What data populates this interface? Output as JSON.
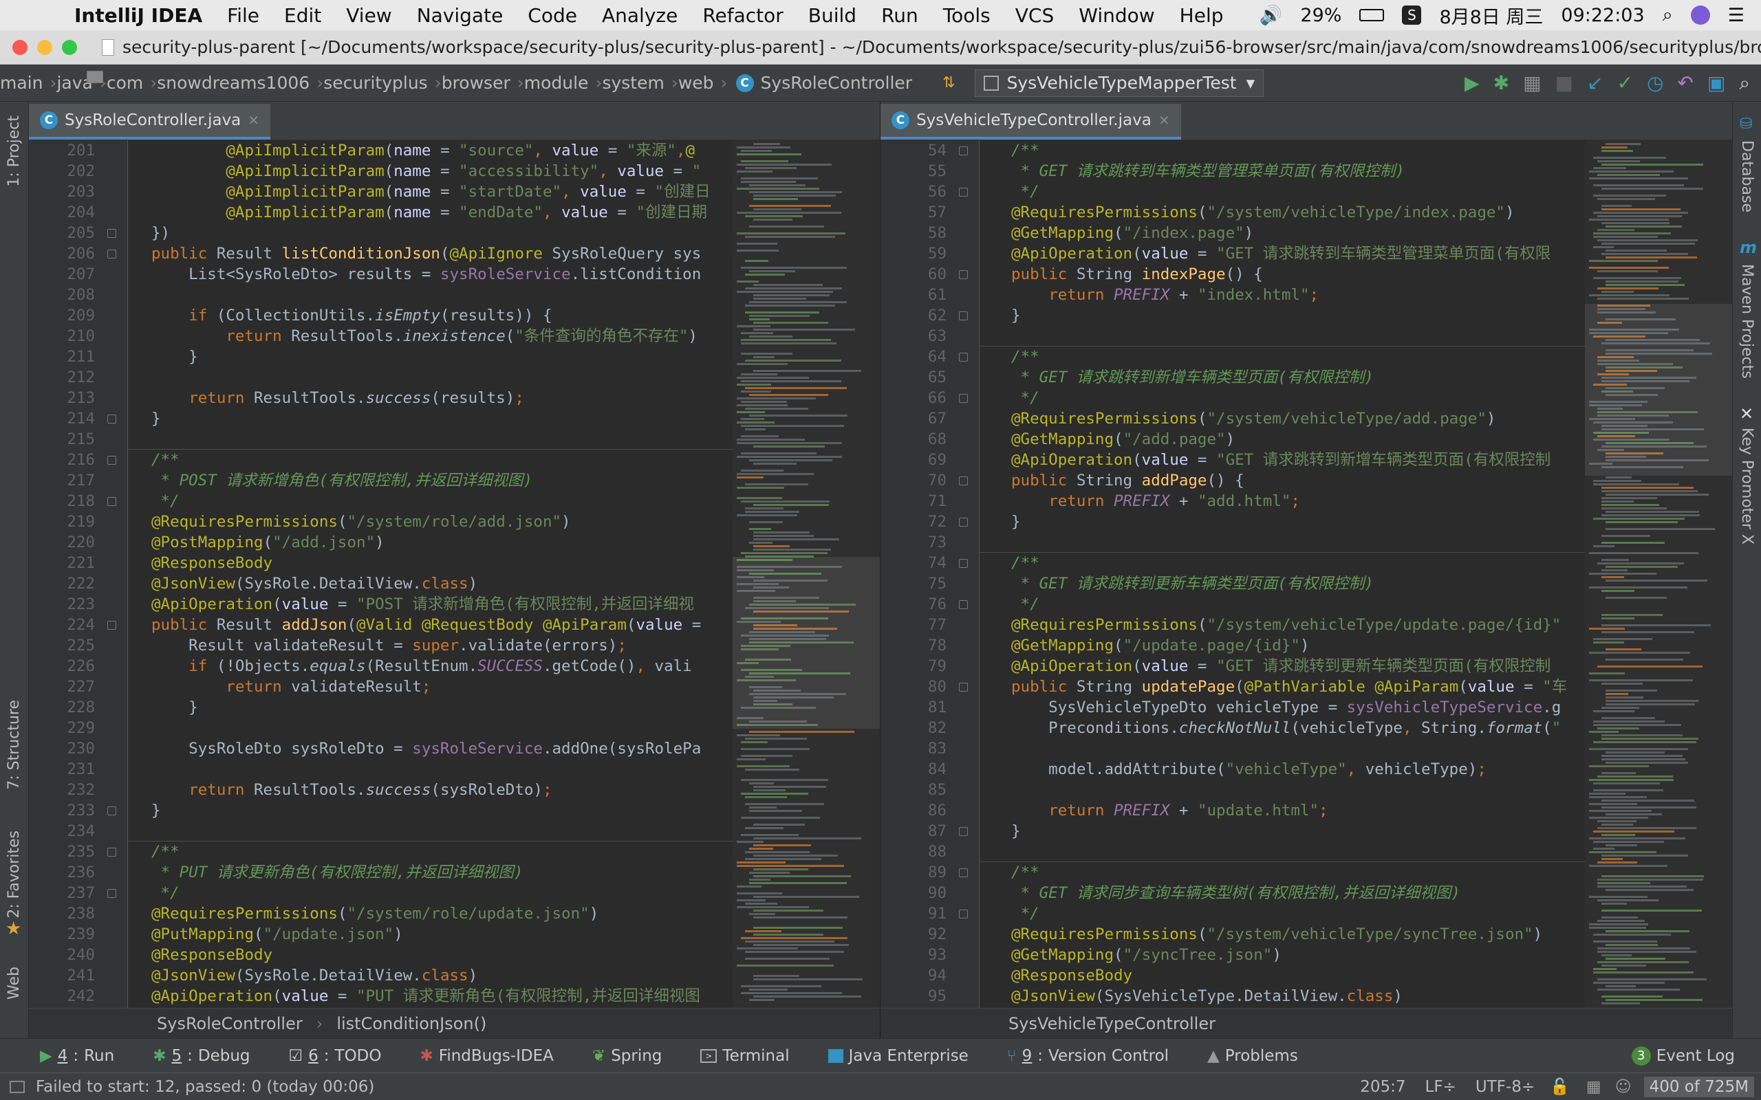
{
  "menubar": {
    "app": "IntelliJ IDEA",
    "items": [
      "File",
      "Edit",
      "View",
      "Navigate",
      "Code",
      "Analyze",
      "Refactor",
      "Build",
      "Run",
      "Tools",
      "VCS",
      "Window",
      "Help"
    ],
    "battery": "29%",
    "date": "8月8日 周三",
    "time": "09:22:03"
  },
  "window": {
    "title": "security-plus-parent [~/Documents/workspace/security-plus/security-plus-parent] - ~/Documents/workspace/security-plus/zui56-browser/src/main/java/com/snowdreams1006/securityplus/bro..."
  },
  "nav": {
    "crumbs": [
      "main",
      "java",
      "com",
      "snowdreams1006",
      "securityplus",
      "browser",
      "module",
      "system",
      "web"
    ],
    "current_class": "SysRoleController",
    "run_config": "SysVehicleTypeMapperTest"
  },
  "left_strip": [
    "1: Project",
    "7: Structure",
    "2: Favorites",
    "Web"
  ],
  "right_strip": [
    "Database",
    "Maven Projects",
    "Key Promoter X"
  ],
  "left_editor": {
    "tab": "SysRoleController.java",
    "breadcrumb": [
      "SysRoleController",
      "listConditionJson()"
    ],
    "lines": [
      {
        "n": "201",
        "t": "        @ApiImplicitParam(name = \"source\", value = \"来源\",@"
      },
      {
        "n": "202",
        "t": "        @ApiImplicitParam(name = \"accessibility\", value = \""
      },
      {
        "n": "203",
        "t": "        @ApiImplicitParam(name = \"startDate\", value = \"创建日"
      },
      {
        "n": "204",
        "t": "        @ApiImplicitParam(name = \"endDate\", value = \"创建日期"
      },
      {
        "n": "205",
        "t": "})"
      },
      {
        "n": "206",
        "t": "public Result listConditionJson(@ApiIgnore SysRoleQuery sys"
      },
      {
        "n": "207",
        "t": "    List<SysRoleDto> results = sysRoleService.listCondition"
      },
      {
        "n": "208",
        "t": ""
      },
      {
        "n": "209",
        "t": "    if (CollectionUtils.isEmpty(results)) {"
      },
      {
        "n": "210",
        "t": "        return ResultTools.inexistence(\"条件查询的角色不存在\")"
      },
      {
        "n": "211",
        "t": "    }"
      },
      {
        "n": "212",
        "t": ""
      },
      {
        "n": "213",
        "t": "    return ResultTools.success(results);"
      },
      {
        "n": "214",
        "t": "}"
      },
      {
        "n": "215",
        "t": ""
      },
      {
        "n": "216",
        "t": "/**"
      },
      {
        "n": "217",
        "t": " * POST 请求新增角色(有权限控制,并返回详细视图)"
      },
      {
        "n": "218",
        "t": " */"
      },
      {
        "n": "219",
        "t": "@RequiresPermissions(\"/system/role/add.json\")"
      },
      {
        "n": "220",
        "t": "@PostMapping(\"/add.json\")"
      },
      {
        "n": "221",
        "t": "@ResponseBody"
      },
      {
        "n": "222",
        "t": "@JsonView(SysRole.DetailView.class)"
      },
      {
        "n": "223",
        "t": "@ApiOperation(value = \"POST 请求新增角色(有权限控制,并返回详细视"
      },
      {
        "n": "224",
        "t": "public Result addJson(@Valid @RequestBody @ApiParam(value ="
      },
      {
        "n": "225",
        "t": "    Result validateResult = super.validate(errors);"
      },
      {
        "n": "226",
        "t": "    if (!Objects.equals(ResultEnum.SUCCESS.getCode(), vali"
      },
      {
        "n": "227",
        "t": "        return validateResult;"
      },
      {
        "n": "228",
        "t": "    }"
      },
      {
        "n": "229",
        "t": ""
      },
      {
        "n": "230",
        "t": "    SysRoleDto sysRoleDto = sysRoleService.addOne(sysRolePa"
      },
      {
        "n": "231",
        "t": ""
      },
      {
        "n": "232",
        "t": "    return ResultTools.success(sysRoleDto);"
      },
      {
        "n": "233",
        "t": "}"
      },
      {
        "n": "234",
        "t": ""
      },
      {
        "n": "235",
        "t": "/**"
      },
      {
        "n": "236",
        "t": " * PUT 请求更新角色(有权限控制,并返回详细视图)"
      },
      {
        "n": "237",
        "t": " */"
      },
      {
        "n": "238",
        "t": "@RequiresPermissions(\"/system/role/update.json\")"
      },
      {
        "n": "239",
        "t": "@PutMapping(\"/update.json\")"
      },
      {
        "n": "240",
        "t": "@ResponseBody"
      },
      {
        "n": "241",
        "t": "@JsonView(SysRole.DetailView.class)"
      },
      {
        "n": "242",
        "t": "@ApiOperation(value = \"PUT 请求更新角色(有权限控制,并返回详细视图"
      }
    ]
  },
  "right_editor": {
    "tab": "SysVehicleTypeController.java",
    "breadcrumb": [
      "SysVehicleTypeController"
    ],
    "lines": [
      {
        "n": "54",
        "t": "/**"
      },
      {
        "n": "55",
        "t": " * GET 请求跳转到车辆类型管理菜单页面(有权限控制)"
      },
      {
        "n": "56",
        "t": " */"
      },
      {
        "n": "57",
        "t": "@RequiresPermissions(\"/system/vehicleType/index.page\")"
      },
      {
        "n": "58",
        "t": "@GetMapping(\"/index.page\")"
      },
      {
        "n": "59",
        "t": "@ApiOperation(value = \"GET 请求跳转到车辆类型管理菜单页面(有权限"
      },
      {
        "n": "60",
        "t": "public String indexPage() {"
      },
      {
        "n": "61",
        "t": "    return PREFIX + \"index.html\";"
      },
      {
        "n": "62",
        "t": "}"
      },
      {
        "n": "63",
        "t": ""
      },
      {
        "n": "64",
        "t": "/**"
      },
      {
        "n": "65",
        "t": " * GET 请求跳转到新增车辆类型页面(有权限控制)"
      },
      {
        "n": "66",
        "t": " */"
      },
      {
        "n": "67",
        "t": "@RequiresPermissions(\"/system/vehicleType/add.page\")"
      },
      {
        "n": "68",
        "t": "@GetMapping(\"/add.page\")"
      },
      {
        "n": "69",
        "t": "@ApiOperation(value = \"GET 请求跳转到新增车辆类型页面(有权限控制"
      },
      {
        "n": "70",
        "t": "public String addPage() {"
      },
      {
        "n": "71",
        "t": "    return PREFIX + \"add.html\";"
      },
      {
        "n": "72",
        "t": "}"
      },
      {
        "n": "73",
        "t": ""
      },
      {
        "n": "74",
        "t": "/**"
      },
      {
        "n": "75",
        "t": " * GET 请求跳转到更新车辆类型页面(有权限控制)"
      },
      {
        "n": "76",
        "t": " */"
      },
      {
        "n": "77",
        "t": "@RequiresPermissions(\"/system/vehicleType/update.page/{id}\""
      },
      {
        "n": "78",
        "t": "@GetMapping(\"/update.page/{id}\")"
      },
      {
        "n": "79",
        "t": "@ApiOperation(value = \"GET 请求跳转到更新车辆类型页面(有权限控制"
      },
      {
        "n": "80",
        "t": "public String updatePage(@PathVariable @ApiParam(value = \"车"
      },
      {
        "n": "81",
        "t": "    SysVehicleTypeDto vehicleType = sysVehicleTypeService.g"
      },
      {
        "n": "82",
        "t": "    Preconditions.checkNotNull(vehicleType, String.format(\""
      },
      {
        "n": "83",
        "t": ""
      },
      {
        "n": "84",
        "t": "    model.addAttribute(\"vehicleType\", vehicleType);"
      },
      {
        "n": "85",
        "t": ""
      },
      {
        "n": "86",
        "t": "    return PREFIX + \"update.html\";"
      },
      {
        "n": "87",
        "t": "}"
      },
      {
        "n": "88",
        "t": ""
      },
      {
        "n": "89",
        "t": "/**"
      },
      {
        "n": "90",
        "t": " * GET 请求同步查询车辆类型树(有权限控制,并返回详细视图)"
      },
      {
        "n": "91",
        "t": " */"
      },
      {
        "n": "92",
        "t": "@RequiresPermissions(\"/system/vehicleType/syncTree.json\")"
      },
      {
        "n": "93",
        "t": "@GetMapping(\"/syncTree.json\")"
      },
      {
        "n": "94",
        "t": "@ResponseBody"
      },
      {
        "n": "95",
        "t": "@JsonView(SysVehicleType.DetailView.class)"
      }
    ]
  },
  "tool_windows": [
    {
      "num": "4",
      "label": "Run"
    },
    {
      "num": "5",
      "label": "Debug"
    },
    {
      "num": "6",
      "label": "TODO"
    },
    {
      "num": "",
      "label": "FindBugs-IDEA"
    },
    {
      "num": "",
      "label": "Spring"
    },
    {
      "num": "",
      "label": "Terminal"
    },
    {
      "num": "",
      "label": "Java Enterprise"
    },
    {
      "num": "9",
      "label": "Version Control"
    },
    {
      "num": "",
      "label": "Problems"
    }
  ],
  "event_log": {
    "count": "3",
    "label": "Event Log"
  },
  "status": {
    "message": "Failed to start: 12, passed: 0 (today 00:06)",
    "position": "205:7",
    "line_sep": "LF÷",
    "encoding": "UTF-8÷",
    "memory": "400 of 725M"
  },
  "colors": {
    "keyword": "#cc7832",
    "string": "#6a8759",
    "doc": "#629755",
    "annotation": "#bbb529",
    "method": "#ffc66d",
    "static": "#9876aa"
  }
}
